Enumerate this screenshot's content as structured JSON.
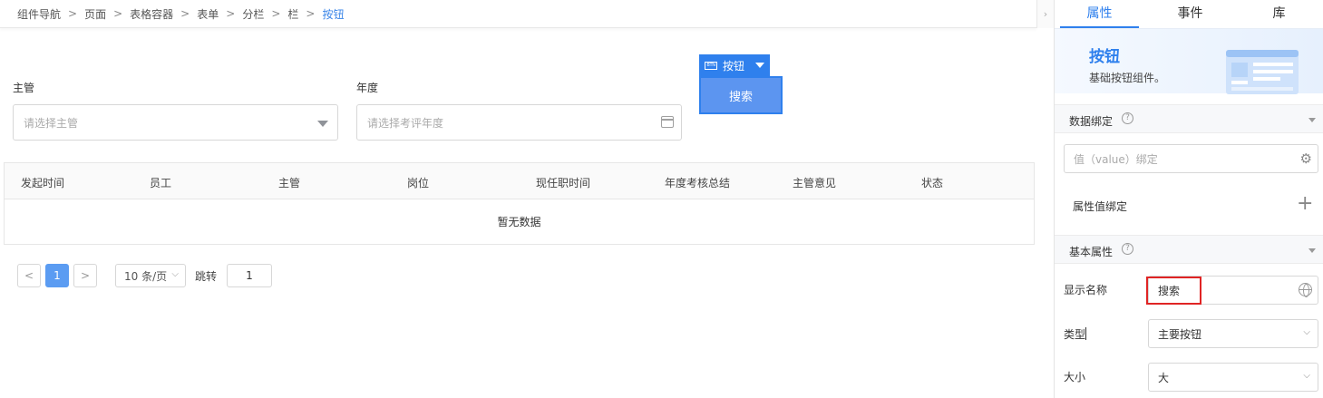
{
  "breadcrumb": {
    "items": [
      "组件导航",
      "页面",
      "表格容器",
      "表单",
      "分栏",
      "栏",
      "按钮"
    ],
    "separator": ">"
  },
  "collapse_toggle": "›",
  "form": {
    "manager_label": "主管",
    "manager_placeholder": "请选择主管",
    "year_label": "年度",
    "year_placeholder": "请选择考评年度"
  },
  "selected_widget": {
    "tag_label": "按钮",
    "tag_icon_text": "BTN",
    "button_label": "搜索"
  },
  "table": {
    "columns": [
      "发起时间",
      "员工",
      "主管",
      "岗位",
      "现任职时间",
      "年度考核总结",
      "主管意见",
      "状态"
    ],
    "empty_text": "暂无数据"
  },
  "pagination": {
    "prev": "<",
    "current": "1",
    "next": ">",
    "page_size": "10 条/页",
    "jump_label": "跳转",
    "jump_value": "1"
  },
  "panel": {
    "tabs": [
      "属性",
      "事件",
      "库"
    ],
    "active_tab": "属性",
    "hero_title": "按钮",
    "hero_subtitle": "基础按钮组件。",
    "data_binding": {
      "title": "数据绑定",
      "value_placeholder": "值（value）绑定",
      "attr_binding_label": "属性值绑定"
    },
    "basic_props": {
      "title": "基本属性",
      "display_name_label": "显示名称",
      "display_name_value": "搜索",
      "type_label": "类型",
      "type_value": "主要按钮",
      "size_label": "大小",
      "size_value": "大"
    }
  },
  "colors": {
    "accent": "#2f80ed",
    "highlight_border": "#e02424"
  }
}
